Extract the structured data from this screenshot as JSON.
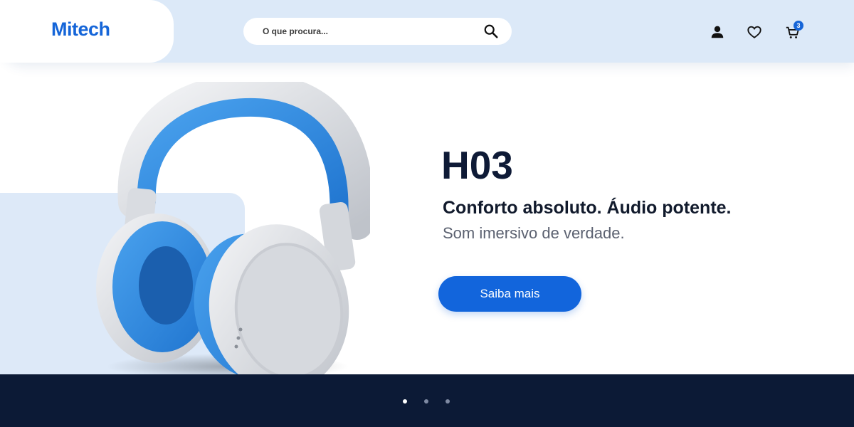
{
  "header": {
    "logo": "Mitech",
    "search": {
      "placeholder": "O que procura...",
      "value": ""
    },
    "icons": [
      "user-icon",
      "heart-icon",
      "cart-icon"
    ],
    "cart_count": "3"
  },
  "hero": {
    "product_name": "H03",
    "tagline": "Conforto absoluto. Áudio potente.",
    "subtitle": "Som imersivo de verdade.",
    "cta_label": "Saiba mais"
  },
  "carousel": {
    "slides": 3,
    "active_index": 0
  },
  "colors": {
    "brand": "#1565d8",
    "header_bg": "#dce9f8",
    "footer_bg": "#0c1a36",
    "headphone_accent": "#2f8ae0"
  }
}
